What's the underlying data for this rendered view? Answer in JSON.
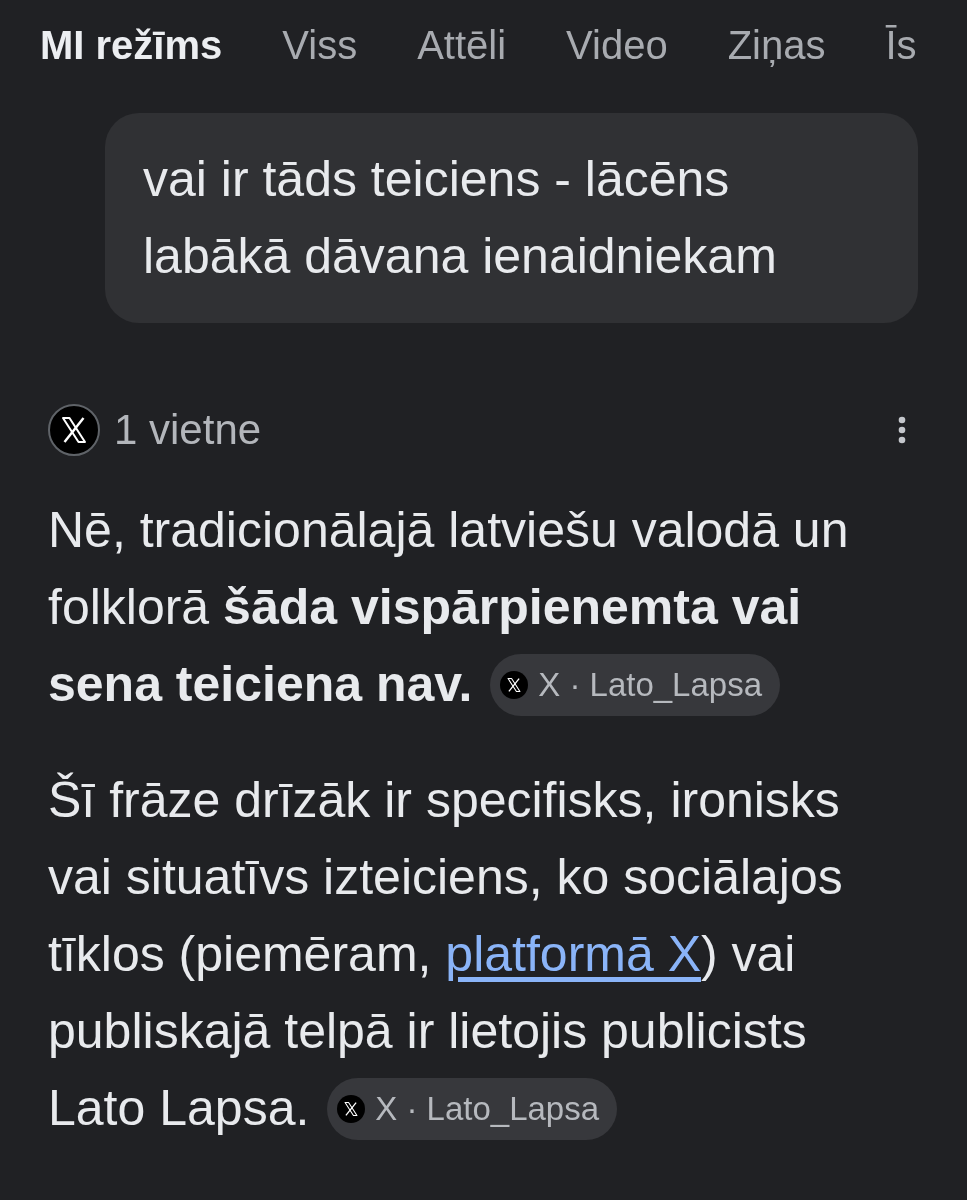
{
  "tabs": [
    {
      "label": "MI režīms",
      "selected": true
    },
    {
      "label": "Viss",
      "selected": false
    },
    {
      "label": "Attēli",
      "selected": false
    },
    {
      "label": "Video",
      "selected": false
    },
    {
      "label": "Ziņas",
      "selected": false
    },
    {
      "label": "Īs",
      "selected": false
    }
  ],
  "query": {
    "text": "vai ir tāds teiciens - lācēns labākā dāvana ienaidniekam"
  },
  "sources": {
    "label": "1 vietne"
  },
  "answer": {
    "paragraphs": [
      {
        "segments": [
          {
            "kind": "text",
            "text": "Nē, tradicionālajā latviešu valodā un folklorā **šāda vispārpienemta vai sena teiciena nav.**"
          }
        ],
        "source_chip": {
          "label": "X · Lato_Lapsa"
        }
      },
      {
        "segments": [
          {
            "kind": "text",
            "text": "Šī frāze drīzāk ir specifisks, ironisks vai situatīvs izteiciens, ko sociālajos tīklos (piemēram, "
          },
          {
            "kind": "link",
            "text": "platformā X"
          },
          {
            "kind": "text",
            "text": ") vai publiskajā telpā ir lietojis publicists Lato Lapsa."
          }
        ],
        "source_chip": {
          "label": "X · Lato_Lapsa"
        }
      }
    ]
  }
}
